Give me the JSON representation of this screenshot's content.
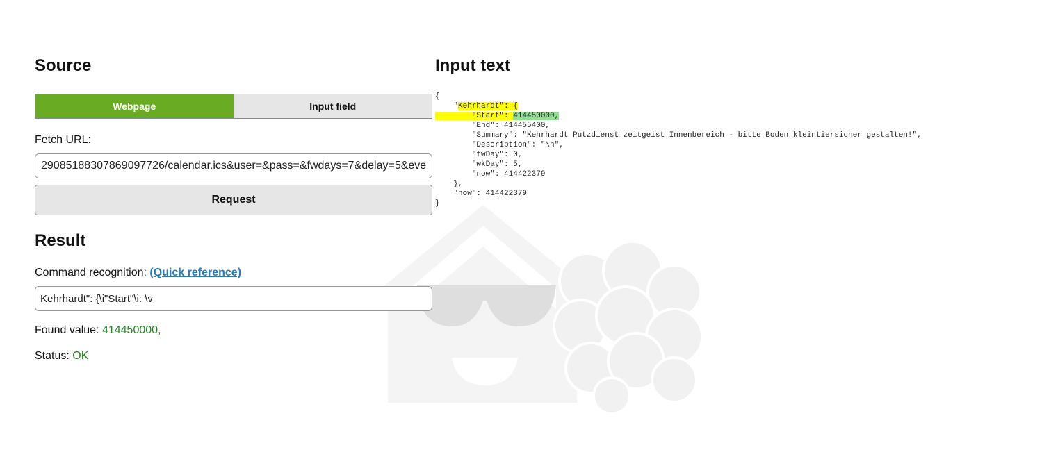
{
  "source": {
    "title": "Source",
    "tabs": [
      {
        "label": "Webpage",
        "active": true
      },
      {
        "label": "Input field",
        "active": false
      }
    ],
    "fetch_label": "Fetch URL:",
    "fetch_url_value": "29085188307869097726/calendar.ics&user=&pass=&fwdays=7&delay=5&eve",
    "request_label": "Request"
  },
  "result": {
    "title": "Result",
    "cmd_label": "Command recognition: ",
    "quick_ref_label": "(Quick reference)",
    "cmd_value": "Kehrhardt\": {\\i\"Start\"\\i: \\v",
    "found_label": "Found value: ",
    "found_value": "414450000,",
    "status_label": "Status: ",
    "status_value": "OK"
  },
  "input_text": {
    "title": "Input text",
    "lines": {
      "l1": "{",
      "l2_pre": "    \"",
      "l2_hl": "Kehrhardt\": {",
      "l3_hl": "        \"Start\": ",
      "l3_green": "414450000,",
      "l4": "        \"End\": 414455400,",
      "l5": "        \"Summary\": \"Kehrhardt Putzdienst zeitgeist Innenbereich - bitte Boden kleintiersicher gestalten!\",",
      "l6": "        \"Description\": \"\\n\",",
      "l7": "        \"fwDay\": 0,",
      "l8": "        \"wkDay\": 5,",
      "l9": "        \"now\": 414422379",
      "l10": "    },",
      "l11": "    \"now\": 414422379",
      "l12": "}"
    }
  },
  "colors": {
    "active_tab": "#6aab24",
    "link": "#2a7ab8",
    "ok_green": "#1e8a1e",
    "highlight_yellow": "#ffff00",
    "highlight_green": "#8fe08f"
  },
  "icons": {
    "watermark": "house-sunglasses-raspberry-logo"
  }
}
